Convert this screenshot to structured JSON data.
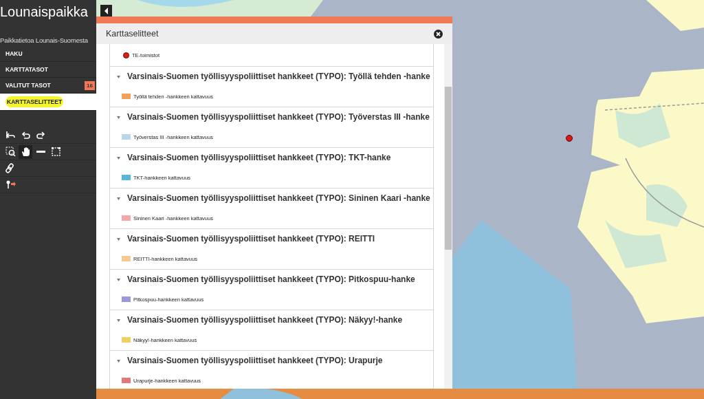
{
  "sidebar": {
    "logo": "Lounaispaikka",
    "subtitle": "Paikkatietoa Lounais-Suomesta",
    "menu": [
      {
        "label": "HAKU",
        "selected": false
      },
      {
        "label": "KARTTATASOT",
        "selected": false
      },
      {
        "label": "VALITUT TASOT",
        "selected": false,
        "badge": "16"
      },
      {
        "label": "KARTTASELITTEET",
        "selected": true
      }
    ],
    "tools": [
      [
        {
          "kind": "home",
          "selected": false
        },
        {
          "kind": "undo",
          "selected": false
        },
        {
          "kind": "redo",
          "selected": false
        }
      ],
      [
        {
          "kind": "zoom",
          "selected": false
        },
        {
          "kind": "pan",
          "selected": true
        },
        {
          "kind": "measure",
          "selected": false
        },
        {
          "kind": "area",
          "selected": false
        }
      ],
      [
        {
          "kind": "link",
          "selected": false
        }
      ],
      [
        {
          "kind": "pin",
          "selected": false
        }
      ]
    ]
  },
  "panel": {
    "title": "Karttaselitteet",
    "top_items": [
      {
        "label": "TE-toimistot",
        "color": "#d42020",
        "kind": "point"
      }
    ],
    "groups": [
      {
        "title": "Varsinais-Suomen työllisyyspoliittiset hankkeet (TYPO): Työllä tehden -hanke",
        "expanded": true,
        "items": [
          {
            "label": "Työllä tehden -hankkeen kattavuus",
            "color": "#f2a15a",
            "kind": "area"
          }
        ]
      },
      {
        "title": "Varsinais-Suomen työllisyyspoliittiset hankkeet (TYPO): Työverstas III -hanke",
        "expanded": true,
        "items": [
          {
            "label": "Työverstas III -hankkeen kattavuus",
            "color": "#b9d7ea",
            "kind": "area"
          }
        ]
      },
      {
        "title": "Varsinais-Suomen työllisyyspoliittiset hankkeet (TYPO): TKT-hanke",
        "expanded": true,
        "items": [
          {
            "label": "TKT-hankkeen kattavuus",
            "color": "#5bb5d5",
            "kind": "area"
          }
        ]
      },
      {
        "title": "Varsinais-Suomen työllisyyspoliittiset hankkeet (TYPO): Sininen Kaari -hanke",
        "expanded": true,
        "items": [
          {
            "label": "Sininen Kaari -hankkeen kattavuus",
            "color": "#f4a9a9",
            "kind": "area"
          }
        ]
      },
      {
        "title": "Varsinais-Suomen työllisyyspoliittiset hankkeet (TYPO): REITTI",
        "expanded": true,
        "items": [
          {
            "label": "REITTI-hankkeen kattavuus",
            "color": "#f6c98e",
            "kind": "area"
          }
        ]
      },
      {
        "title": "Varsinais-Suomen työllisyyspoliittiset hankkeet (TYPO): Pitkospuu-hanke",
        "expanded": true,
        "items": [
          {
            "label": "Pitkospuu-hankkeen kattavuus",
            "color": "#9c97d6",
            "kind": "area"
          }
        ]
      },
      {
        "title": "Varsinais-Suomen työllisyyspoliittiset hankkeet (TYPO): Näkyy!-hanke",
        "expanded": true,
        "items": [
          {
            "label": "Näkyy!-hankkeen kattavuus",
            "color": "#efd062",
            "kind": "area"
          }
        ]
      },
      {
        "title": "Varsinais-Suomen työllisyyspoliittiset hankkeet (TYPO): Urapurje",
        "expanded": true,
        "items": [
          {
            "label": "Urapurje-hankkeen kattavuus",
            "color": "#e07a7a",
            "kind": "area"
          }
        ]
      }
    ]
  }
}
